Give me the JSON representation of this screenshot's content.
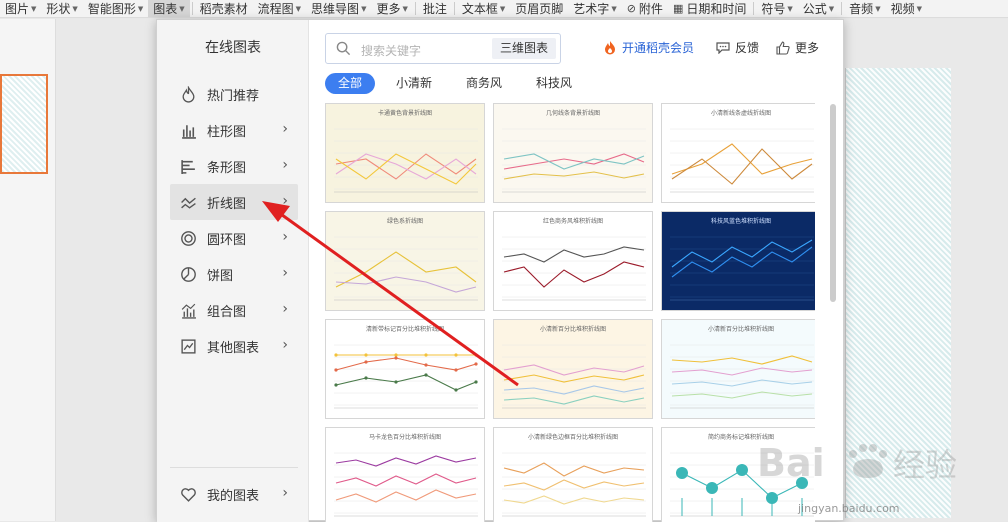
{
  "toolbar": [
    {
      "label": "图片",
      "caret": true
    },
    {
      "label": "形状",
      "caret": true
    },
    {
      "label": "智能图形",
      "caret": true
    },
    {
      "label": "图表",
      "caret": true,
      "active": true
    },
    {
      "label": "稻壳素材",
      "caret": false
    },
    {
      "label": "流程图",
      "caret": true
    },
    {
      "label": "思维导图",
      "caret": true
    },
    {
      "label": "更多",
      "caret": true
    },
    {
      "label": "批注",
      "caret": false
    },
    {
      "label": "文本框",
      "caret": true
    },
    {
      "label": "页眉页脚",
      "caret": false
    },
    {
      "label": "艺术字",
      "caret": true
    },
    {
      "label": "附件",
      "caret": false,
      "icon": "paperclip-icon"
    },
    {
      "label": "日期和时间",
      "caret": false,
      "icon": "calendar-icon"
    },
    {
      "label": "符号",
      "caret": true
    },
    {
      "label": "公式",
      "caret": true
    },
    {
      "label": "音频",
      "caret": true
    },
    {
      "label": "视频",
      "caret": true
    }
  ],
  "sidebar": {
    "title": "在线图表",
    "items": [
      {
        "label": "热门推荐",
        "icon": "flame-icon",
        "chevron": false
      },
      {
        "label": "柱形图",
        "icon": "column-chart-icon",
        "chevron": true
      },
      {
        "label": "条形图",
        "icon": "bar-chart-icon",
        "chevron": true
      },
      {
        "label": "折线图",
        "icon": "line-chart-icon",
        "chevron": true,
        "active": true
      },
      {
        "label": "圆环图",
        "icon": "donut-chart-icon",
        "chevron": true
      },
      {
        "label": "饼图",
        "icon": "pie-chart-icon",
        "chevron": true
      },
      {
        "label": "组合图",
        "icon": "combo-chart-icon",
        "chevron": true
      },
      {
        "label": "其他图表",
        "icon": "other-chart-icon",
        "chevron": true
      }
    ],
    "my_charts": "我的图表"
  },
  "search": {
    "placeholder": "搜索关键字",
    "tag": "三维图表"
  },
  "header": {
    "member": "开通稻壳会员",
    "feedback": "反馈",
    "more": "更多"
  },
  "filters": [
    "全部",
    "小清新",
    "商务风",
    "科技风"
  ],
  "cards": [
    {
      "title": "卡通黄色背景折线图",
      "bg": "#f7f3df",
      "lines": [
        "#f08a7a",
        "#e7a8d8",
        "#f3c73a",
        "#9ab8e0"
      ]
    },
    {
      "title": "几何线条背景折线图",
      "bg": "#fbf8f0",
      "lines": [
        "#e76b8a",
        "#7ec4c4",
        "#e3c04a",
        "#a6d"
      ]
    },
    {
      "title": "小清新线条虚线折线图",
      "bg": "#ffffff",
      "lines": [
        "#e8a23a",
        "#cd8a3c",
        "#e6c24a"
      ]
    },
    {
      "title": "绿色系折线图",
      "bg": "#f8f5e6",
      "lines": [
        "#e7c23a",
        "#c5a7d8",
        "#c8a88a"
      ]
    },
    {
      "title": "红色商务风堆积折线图",
      "bg": "#ffffff",
      "lines": [
        "#9b1b2a",
        "#555555"
      ]
    },
    {
      "title": "科技风蓝色堆积折线图",
      "bg": "#0b2a66",
      "lines": [
        "#2f8ff0",
        "#3aa6ff"
      ]
    },
    {
      "title": "清新带标记百分比堆积折线图",
      "bg": "#ffffff",
      "lines": [
        "#f3c23a",
        "#e36a4a",
        "#4a7a4a"
      ]
    },
    {
      "title": "小清新百分比堆积折线图",
      "bg": "#fdf5e4",
      "lines": [
        "#e3a0d0",
        "#f0c03a",
        "#a8c8e8",
        "#8ad0c0"
      ]
    },
    {
      "title": "小清新百分比堆积折线图",
      "bg": "#f4fbfd",
      "lines": [
        "#f0c03a",
        "#e3a0d0",
        "#a8d0e8",
        "#b8e0a8"
      ]
    },
    {
      "title": "马卡龙色百分比堆积折线图",
      "bg": "#ffffff",
      "lines": [
        "#9b3aa0",
        "#e05a8a",
        "#f09a7a"
      ]
    },
    {
      "title": "小清新绿色边框百分比堆积折线图",
      "bg": "#ffffff",
      "lines": [
        "#e8a05a",
        "#f0c070",
        "#f0d890"
      ]
    },
    {
      "title": "简约商务标记堆积折线图",
      "bg": "#ffffff",
      "lines": [
        "#3ab7b7"
      ]
    }
  ]
}
